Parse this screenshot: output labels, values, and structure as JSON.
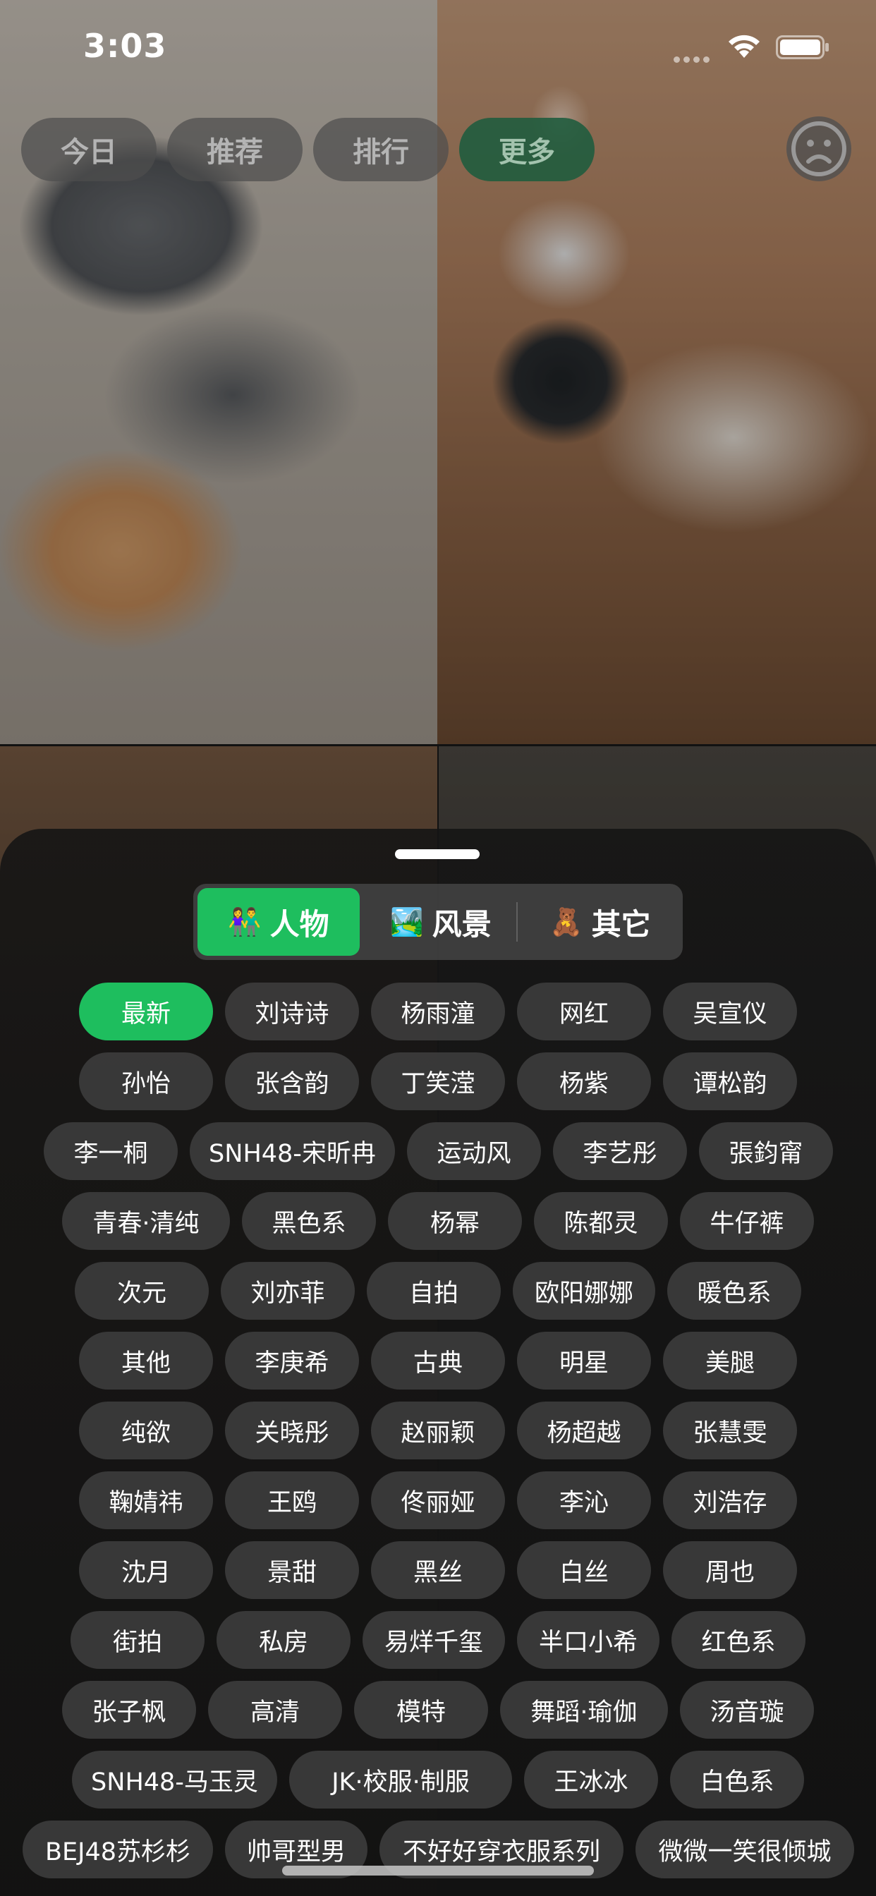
{
  "status_bar": {
    "time": "3:03"
  },
  "top_tabs": [
    {
      "label": "今日",
      "active": false
    },
    {
      "label": "推荐",
      "active": false
    },
    {
      "label": "排行",
      "active": false
    },
    {
      "label": "更多",
      "active": true
    }
  ],
  "face_icon": "sad-face-icon",
  "segmented": [
    {
      "emoji": "👫",
      "label": "人物",
      "active": true
    },
    {
      "emoji": "🏞️",
      "label": "风景",
      "active": false
    },
    {
      "emoji": "🧸",
      "label": "其它",
      "active": false
    }
  ],
  "tags": [
    [
      "最新",
      "刘诗诗",
      "杨雨潼",
      "网红",
      "吴宣仪"
    ],
    [
      "孙怡",
      "张含韵",
      "丁笑滢",
      "杨紫",
      "谭松韵"
    ],
    [
      "李一桐",
      "SNH48-宋昕冉",
      "运动风",
      "李艺彤",
      "張鈞甯"
    ],
    [
      "青春·清纯",
      "黑色系",
      "杨幂",
      "陈都灵",
      "牛仔裤"
    ],
    [
      "次元",
      "刘亦菲",
      "自拍",
      "欧阳娜娜",
      "暖色系"
    ],
    [
      "其他",
      "李庚希",
      "古典",
      "明星",
      "美腿"
    ],
    [
      "纯欲",
      "关晓彤",
      "赵丽颖",
      "杨超越",
      "张慧雯"
    ],
    [
      "鞠婧祎",
      "王鸥",
      "佟丽娅",
      "李沁",
      "刘浩存"
    ],
    [
      "沈月",
      "景甜",
      "黑丝",
      "白丝",
      "周也"
    ],
    [
      "街拍",
      "私房",
      "易烊千玺",
      "半口小希",
      "红色系"
    ],
    [
      "张子枫",
      "高清",
      "模特",
      "舞蹈·瑜伽",
      "汤音璇"
    ],
    [
      "SNH48-马玉灵",
      "JK·校服·制服",
      "王冰冰",
      "白色系"
    ],
    [
      "BEJ48苏杉杉",
      "帅哥型男",
      "不好好穿衣服系列",
      "微微一笑很倾城"
    ]
  ],
  "active_tag": "最新"
}
